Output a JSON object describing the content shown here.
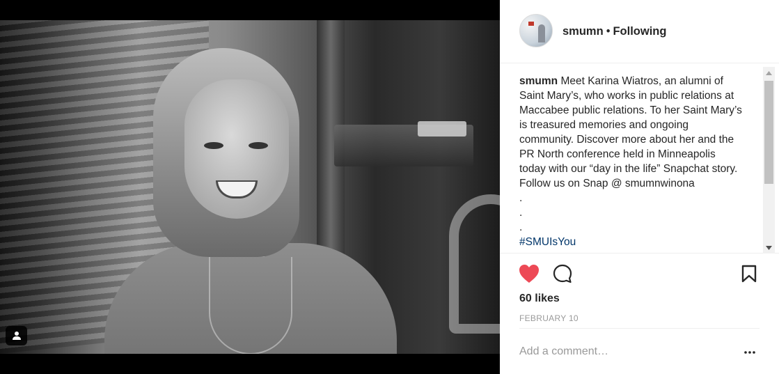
{
  "post": {
    "username": "smumn",
    "separator": "•",
    "follow_status": "Following",
    "caption_user": "smumn",
    "caption_text": "Meet Karina Wiatros, an alumni of Saint Mary’s, who works in public relations at Maccabee public relations. To her Saint Mary’s is treasured memories and ongoing community. Discover more about her and the PR North conference held in Minneapolis today with our “day in the life” Snapchat story. Follow us on Snap @ smumnwinona",
    "continuation": [
      ".",
      ".",
      "."
    ],
    "hashtag_partial": "#SMUIsYou",
    "likes": "60 likes",
    "date": "FEBRUARY 10",
    "comment_placeholder": "Add a comment…",
    "liked": true
  },
  "icons": {
    "avatar": "profile-avatar",
    "tag": "user-tag-icon",
    "like": "heart-icon",
    "comment": "comment-icon",
    "save": "bookmark-icon",
    "more": "more-options-icon"
  },
  "colors": {
    "heart": "#ed4956",
    "text": "#262626",
    "muted": "#999999",
    "hashtag": "#003569"
  }
}
